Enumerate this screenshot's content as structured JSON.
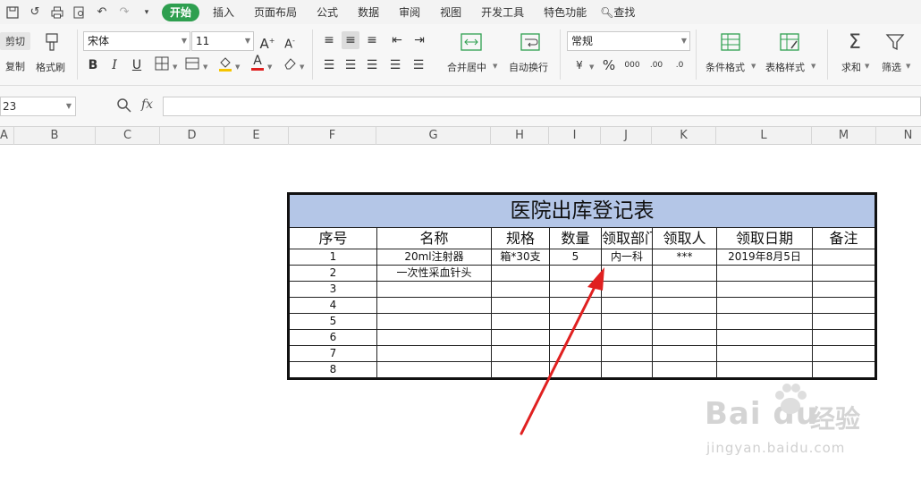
{
  "menu": {
    "tabs": [
      "开始",
      "插入",
      "页面布局",
      "公式",
      "数据",
      "审阅",
      "视图",
      "开发工具",
      "特色功能"
    ],
    "active_tab": "开始",
    "search_label": "查找"
  },
  "ribbon": {
    "cut_label": "剪切",
    "copy_label": "复制",
    "format_painter_label": "格式刷",
    "font_name": "宋体",
    "font_size": "11",
    "bold": "B",
    "italic": "I",
    "underline": "U",
    "font_color_glyph": "A",
    "merge_center_label": "合并居中",
    "wrap_text_label": "自动换行",
    "number_format": "常规",
    "percent": "%",
    "conditional_format_label": "条件格式",
    "table_style_label": "表格样式",
    "sum_label": "求和",
    "filter_label": "筛选"
  },
  "formula_bar": {
    "cell_ref": "23",
    "fx": "fx",
    "formula": ""
  },
  "columns": [
    "A",
    "B",
    "C",
    "D",
    "E",
    "F",
    "G",
    "H",
    "I",
    "J",
    "K",
    "L",
    "M",
    "N"
  ],
  "table": {
    "title": "医院出库登记表",
    "headers": [
      "序号",
      "名称",
      "规格",
      "数量",
      "领取部门",
      "领取人",
      "领取日期",
      "备注"
    ],
    "rows": [
      [
        "1",
        "20ml注射器",
        "箱*30支",
        "5",
        "内一科",
        "***",
        "2019年8月5日",
        ""
      ],
      [
        "2",
        "一次性采血针头",
        "",
        "",
        "",
        "",
        "",
        ""
      ],
      [
        "3",
        "",
        "",
        "",
        "",
        "",
        "",
        ""
      ],
      [
        "4",
        "",
        "",
        "",
        "",
        "",
        "",
        ""
      ],
      [
        "5",
        "",
        "",
        "",
        "",
        "",
        "",
        ""
      ],
      [
        "6",
        "",
        "",
        "",
        "",
        "",
        "",
        ""
      ],
      [
        "7",
        "",
        "",
        "",
        "",
        "",
        "",
        ""
      ],
      [
        "8",
        "",
        "",
        "",
        "",
        "",
        "",
        ""
      ]
    ]
  },
  "watermark": {
    "logo": "Bai du",
    "cn": "经验",
    "url": "jingyan.baidu.com"
  },
  "colors": {
    "accent": "#2e9f4f",
    "title_fill": "#b4c6e7",
    "arrow": "#e02020"
  }
}
